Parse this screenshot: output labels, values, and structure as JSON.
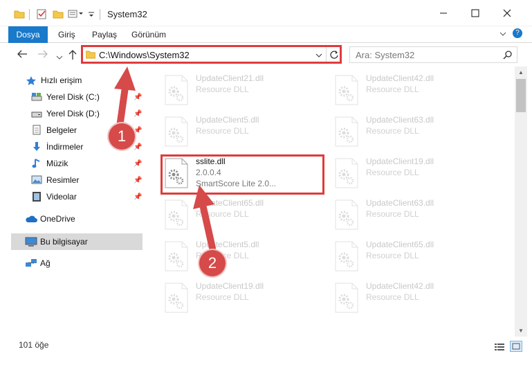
{
  "window": {
    "title": "System32",
    "minimize_icon": "minimize-icon",
    "maximize_icon": "maximize-icon",
    "close_icon": "close-icon"
  },
  "ribbon": {
    "tabs": [
      "Dosya",
      "Giriş",
      "Paylaş",
      "Görünüm"
    ]
  },
  "address": {
    "path": "C:\\Windows\\System32",
    "search_placeholder": "Ara: System32"
  },
  "sidebar": {
    "items": [
      {
        "label": "Hızlı erişim",
        "icon": "star-icon",
        "pinned": false
      },
      {
        "label": "Yerel Disk (C:)",
        "icon": "drive-icon",
        "pinned": true
      },
      {
        "label": "Yerel Disk (D:)",
        "icon": "drive-icon",
        "pinned": true
      },
      {
        "label": "Belgeler",
        "icon": "documents-icon",
        "pinned": true
      },
      {
        "label": "İndirmeler",
        "icon": "download-icon",
        "pinned": true
      },
      {
        "label": "Müzik",
        "icon": "music-icon",
        "pinned": true
      },
      {
        "label": "Resimler",
        "icon": "pictures-icon",
        "pinned": true
      },
      {
        "label": "Videolar",
        "icon": "video-icon",
        "pinned": true
      },
      {
        "label": "OneDrive",
        "icon": "cloud-icon",
        "pinned": false
      },
      {
        "label": "Bu bilgisayar",
        "icon": "computer-icon",
        "pinned": false
      },
      {
        "label": "Ağ",
        "icon": "network-icon",
        "pinned": false
      }
    ]
  },
  "files": [
    {
      "name": "UpdateClient21.dll",
      "desc": "Resource DLL"
    },
    {
      "name": "UpdateClient42.dll",
      "desc": "Resource DLL"
    },
    {
      "name": "UpdateClient5.dll",
      "desc": "Resource DLL"
    },
    {
      "name": "UpdateClient63.dll",
      "desc": "Resource DLL"
    },
    {
      "name": "sslite.dll",
      "version": "2.0.0.4",
      "desc": "SmartScore Lite 2.0..."
    },
    {
      "name": "UpdateClient19.dll",
      "desc": "Resource DLL"
    },
    {
      "name": "UpdateClient65.dll",
      "desc": "Resource DLL"
    },
    {
      "name": "UpdateClient63.dll",
      "desc": "Resource DLL"
    },
    {
      "name": "UpdateClient5.dll",
      "desc": "Resource DLL"
    },
    {
      "name": "UpdateClient65.dll",
      "desc": "Resource DLL"
    },
    {
      "name": "UpdateClient19.dll",
      "desc": "Resource DLL"
    },
    {
      "name": "UpdateClient42.dll",
      "desc": "Resource DLL"
    }
  ],
  "annotations": {
    "badge1": "1",
    "badge2": "2",
    "highlight_color": "#e03b3b"
  },
  "status": {
    "count": "101 öğe"
  },
  "colors": {
    "accent": "#1979ca",
    "selection": "#d9d9d9"
  }
}
